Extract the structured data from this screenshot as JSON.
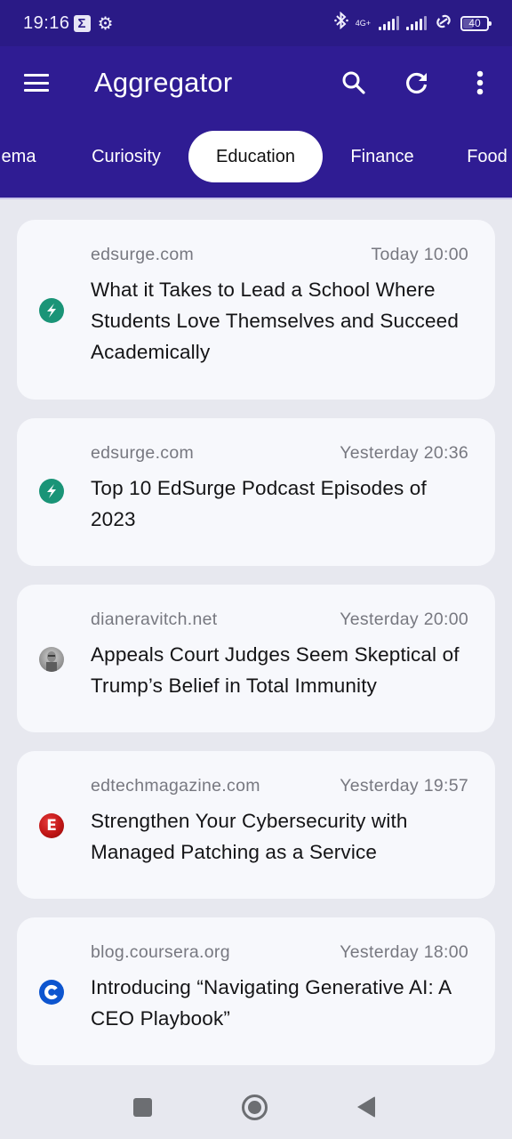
{
  "status_bar": {
    "time": "19:16",
    "left_icons": [
      "sigma-notification-icon",
      "settings-gear-icon"
    ],
    "network_label": "4G+",
    "battery_level": "40",
    "right_icons": [
      "bluetooth-icon",
      "signal-strength-icon",
      "signal-strength-icon-2",
      "hotspot-link-icon",
      "battery-icon"
    ]
  },
  "app_bar": {
    "title": "Aggregator",
    "menu_icon": "hamburger-menu-icon",
    "actions": [
      {
        "name": "search",
        "icon": "search-icon"
      },
      {
        "name": "refresh",
        "icon": "refresh-icon"
      },
      {
        "name": "more",
        "icon": "more-vert-icon"
      }
    ]
  },
  "tabs": {
    "items": [
      {
        "label": "ema",
        "active": false
      },
      {
        "label": "Curiosity",
        "active": false
      },
      {
        "label": "Education",
        "active": true
      },
      {
        "label": "Finance",
        "active": false
      },
      {
        "label": "Food",
        "active": false
      }
    ]
  },
  "colors": {
    "app_bar": "#2f1c93",
    "status_bar": "#2a1a86",
    "background": "#e7e8ef",
    "card": "#f7f8fc"
  },
  "feed": {
    "articles": [
      {
        "source": "edsurge.com",
        "time": "Today 10:00",
        "title": "What it Takes to Lead a School Where Students Love Themselves and Succeed Academically",
        "favicon": "edsurge-lightning-icon"
      },
      {
        "source": "edsurge.com",
        "time": "Yesterday 20:36",
        "title": "Top 10 EdSurge Podcast Episodes of 2023",
        "favicon": "edsurge-lightning-icon"
      },
      {
        "source": "dianeravitch.net",
        "time": "Yesterday 20:00",
        "title": "Appeals Court Judges Seem Skeptical of Trump’s Belief in Total Immunity",
        "favicon": "dianeravitch-avatar-icon"
      },
      {
        "source": "edtechmagazine.com",
        "time": "Yesterday 19:57",
        "title": "Strengthen Your Cybersecurity with Managed Patching as a Service",
        "favicon": "edtech-et-icon",
        "favicon_text": "E"
      },
      {
        "source": "blog.coursera.org",
        "time": "Yesterday 18:00",
        "title": "Introducing “Navigating Generative AI: A CEO Playbook”",
        "favicon": "coursera-c-icon"
      }
    ]
  },
  "nav_bar": {
    "buttons": [
      "recents-square-icon",
      "home-circle-icon",
      "back-triangle-icon"
    ]
  }
}
